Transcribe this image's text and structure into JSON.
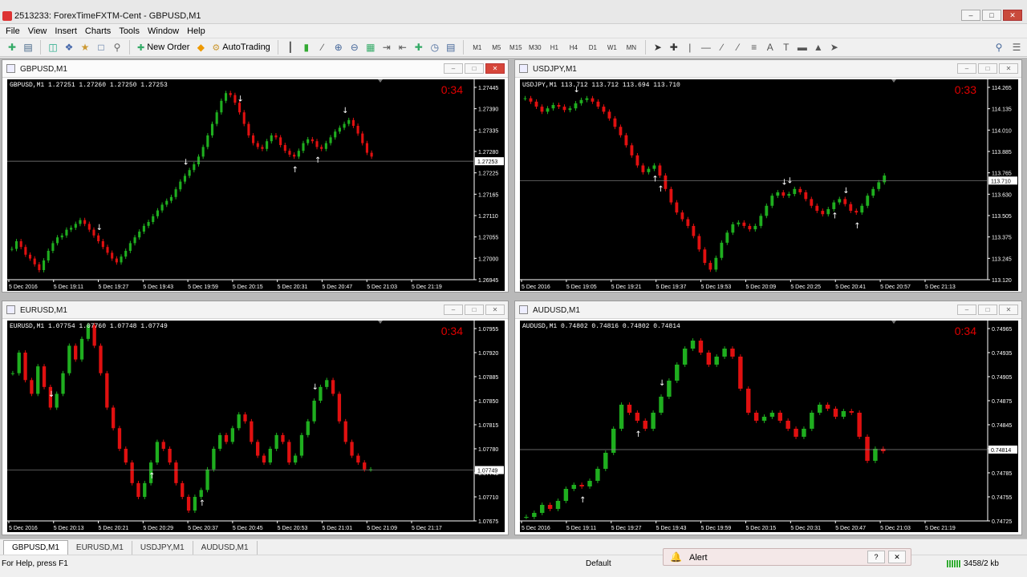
{
  "app": {
    "title": "2513233: ForexTimeFXTM-Cent - GBPUSD,M1"
  },
  "menu": [
    "File",
    "View",
    "Insert",
    "Charts",
    "Tools",
    "Window",
    "Help"
  ],
  "toolbar": {
    "new_order": "New Order",
    "autotrading": "AutoTrading",
    "timeframes": [
      "M1",
      "M5",
      "M15",
      "M30",
      "H1",
      "H4",
      "D1",
      "W1",
      "MN"
    ]
  },
  "charts": [
    {
      "title": "GBPUSD,M1",
      "symbol_line": "GBPUSD,M1  1.27251 1.27260 1.27250 1.27253",
      "timer": "0:34",
      "bid_label": "1.27253",
      "price_labels": [
        "1.27445",
        "1.27390",
        "1.27335",
        "1.27280",
        "1.27225",
        "1.27165",
        "1.27110",
        "1.27055",
        "1.27000",
        "1.26945"
      ],
      "time_labels": [
        "5 Dec 2016",
        "5 Dec 19:11",
        "5 Dec 19:27",
        "5 Dec 19:43",
        "5 Dec 19:59",
        "5 Dec 20:15",
        "5 Dec 20:31",
        "5 Dec 20:47",
        "5 Dec 21:03",
        "5 Dec 21:19"
      ],
      "series": [
        1.27025,
        1.27045,
        1.2703,
        1.2701,
        1.27,
        1.26985,
        1.2697,
        1.26995,
        1.2702,
        1.2704,
        1.27055,
        1.2706,
        1.27075,
        1.2708,
        1.2709,
        1.271,
        1.2709,
        1.27075,
        1.2706,
        1.27045,
        1.2703,
        1.27015,
        1.27,
        1.2699,
        1.27005,
        1.2702,
        1.2704,
        1.27055,
        1.2707,
        1.27085,
        1.27095,
        1.2711,
        1.27125,
        1.2714,
        1.2715,
        1.2716,
        1.2718,
        1.272,
        1.27215,
        1.2723,
        1.27245,
        1.27265,
        1.2729,
        1.2732,
        1.2735,
        1.2738,
        1.2741,
        1.2743,
        1.27425,
        1.27405,
        1.2738,
        1.2735,
        1.2732,
        1.273,
        1.2729,
        1.27285,
        1.27305,
        1.2732,
        1.27315,
        1.27295,
        1.2728,
        1.2727,
        1.27265,
        1.2728,
        1.273,
        1.2731,
        1.27305,
        1.2729,
        1.27285,
        1.273,
        1.27315,
        1.2733,
        1.2734,
        1.2735,
        1.2736,
        1.27345,
        1.27325,
        1.273,
        1.27275,
        1.27265
      ],
      "arrows": [
        {
          "i": 19,
          "dir": "down"
        },
        {
          "i": 38,
          "dir": "down"
        },
        {
          "i": 50,
          "dir": "down"
        },
        {
          "i": 62,
          "dir": "up"
        },
        {
          "i": 67,
          "dir": "up"
        },
        {
          "i": 73,
          "dir": "down"
        }
      ]
    },
    {
      "title": "USDJPY,M1",
      "symbol_line": "USDJPY,M1  113.712 113.712 113.694 113.710",
      "timer": "0:33",
      "bid_label": "113.710",
      "price_labels": [
        "114.265",
        "114.135",
        "114.010",
        "113.885",
        "113.765",
        "113.630",
        "113.505",
        "113.375",
        "113.245",
        "113.120"
      ],
      "time_labels": [
        "5 Dec 2016",
        "5 Dec 19:05",
        "5 Dec 19:21",
        "5 Dec 19:37",
        "5 Dec 19:53",
        "5 Dec 20:09",
        "5 Dec 20:25",
        "5 Dec 20:41",
        "5 Dec 20:57",
        "5 Dec 21:13"
      ],
      "series": [
        114.2,
        114.18,
        114.15,
        114.12,
        114.14,
        114.16,
        114.15,
        114.13,
        114.14,
        114.17,
        114.19,
        114.2,
        114.18,
        114.15,
        114.12,
        114.08,
        114.03,
        113.98,
        113.92,
        113.86,
        113.8,
        113.76,
        113.78,
        113.8,
        113.74,
        113.66,
        113.58,
        113.52,
        113.48,
        113.44,
        113.38,
        113.3,
        113.22,
        113.18,
        113.25,
        113.34,
        113.4,
        113.45,
        113.46,
        113.44,
        113.42,
        113.44,
        113.5,
        113.56,
        113.62,
        113.64,
        113.62,
        113.63,
        113.66,
        113.64,
        113.6,
        113.56,
        113.53,
        113.51,
        113.54,
        113.58,
        113.6,
        113.57,
        113.53,
        113.52,
        113.56,
        113.62,
        113.66,
        113.7,
        113.74
      ],
      "arrows": [
        {
          "i": 9,
          "dir": "down"
        },
        {
          "i": 23,
          "dir": "up"
        },
        {
          "i": 24,
          "dir": "up"
        },
        {
          "i": 46,
          "dir": "down"
        },
        {
          "i": 47,
          "dir": "down"
        },
        {
          "i": 55,
          "dir": "up"
        },
        {
          "i": 57,
          "dir": "down"
        },
        {
          "i": 59,
          "dir": "up"
        }
      ]
    },
    {
      "title": "EURUSD,M1",
      "symbol_line": "EURUSD,M1  1.07754 1.07760 1.07748 1.07749",
      "timer": "0:34",
      "bid_label": "1.07749",
      "price_labels": [
        "1.07955",
        "1.07920",
        "1.07885",
        "1.07850",
        "1.07815",
        "1.07780",
        "1.07745",
        "1.07710",
        "1.07675"
      ],
      "time_labels": [
        "5 Dec 2016",
        "5 Dec 20:13",
        "5 Dec 20:21",
        "5 Dec 20:29",
        "5 Dec 20:37",
        "5 Dec 20:45",
        "5 Dec 20:53",
        "5 Dec 21:01",
        "5 Dec 21:09",
        "5 Dec 21:17"
      ],
      "series": [
        1.0789,
        1.0792,
        1.0788,
        1.0786,
        1.079,
        1.0787,
        1.0784,
        1.0786,
        1.0789,
        1.0793,
        1.0791,
        1.0794,
        1.0796,
        1.0793,
        1.0789,
        1.0784,
        1.0781,
        1.0778,
        1.0776,
        1.0773,
        1.0771,
        1.0773,
        1.0776,
        1.0779,
        1.0778,
        1.0776,
        1.0773,
        1.0771,
        1.0769,
        1.0771,
        1.0772,
        1.0775,
        1.0778,
        1.078,
        1.0779,
        1.0781,
        1.0783,
        1.0782,
        1.0779,
        1.0777,
        1.0776,
        1.0778,
        1.078,
        1.0779,
        1.0776,
        1.0777,
        1.078,
        1.0782,
        1.0785,
        1.0787,
        1.0788,
        1.0786,
        1.0782,
        1.0779,
        1.0777,
        1.0776,
        1.0775,
        1.0775
      ],
      "arrows": [
        {
          "i": 6,
          "dir": "down"
        },
        {
          "i": 22,
          "dir": "up"
        },
        {
          "i": 30,
          "dir": "up"
        },
        {
          "i": 48,
          "dir": "down"
        }
      ]
    },
    {
      "title": "AUDUSD,M1",
      "symbol_line": "AUDUSD,M1  0.74802 0.74816 0.74802 0.74814",
      "timer": "0:34",
      "bid_label": "0.74814",
      "price_labels": [
        "0.74965",
        "0.74935",
        "0.74905",
        "0.74875",
        "0.74845",
        "0.74815",
        "0.74785",
        "0.74755",
        "0.74725"
      ],
      "time_labels": [
        "5 Dec 2016",
        "5 Dec 19:11",
        "5 Dec 19:27",
        "5 Dec 19:43",
        "5 Dec 19:59",
        "5 Dec 20:15",
        "5 Dec 20:31",
        "5 Dec 20:47",
        "5 Dec 21:03",
        "5 Dec 21:19"
      ],
      "series": [
        0.7473,
        0.74735,
        0.74745,
        0.7474,
        0.7475,
        0.74765,
        0.7477,
        0.74768,
        0.74775,
        0.7479,
        0.7481,
        0.7484,
        0.7487,
        0.7486,
        0.7485,
        0.7484,
        0.7486,
        0.7488,
        0.749,
        0.7492,
        0.7494,
        0.7495,
        0.74935,
        0.7492,
        0.7493,
        0.7494,
        0.7493,
        0.7489,
        0.7486,
        0.7485,
        0.74855,
        0.7486,
        0.7485,
        0.7484,
        0.7483,
        0.7484,
        0.7486,
        0.7487,
        0.74865,
        0.74855,
        0.74862,
        0.7486,
        0.7483,
        0.748,
        0.74815,
        0.74812
      ],
      "arrows": [
        {
          "i": 7,
          "dir": "up"
        },
        {
          "i": 14,
          "dir": "up"
        },
        {
          "i": 17,
          "dir": "down"
        }
      ]
    }
  ],
  "tabs": [
    "GBPUSD,M1",
    "EURUSD,M1",
    "USDJPY,M1",
    "AUDUSD,M1"
  ],
  "status": {
    "help": "For Help, press F1",
    "profile": "Default",
    "alert": "Alert",
    "traffic": "3458/2 kb"
  }
}
